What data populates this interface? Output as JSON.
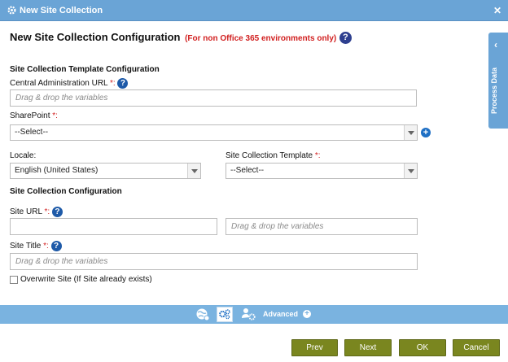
{
  "window": {
    "title": "New Site Collection",
    "icon": "gear-icon",
    "close_icon": "close-icon"
  },
  "heading": {
    "title": "New Site Collection Configuration",
    "note": "(For non Office 365 environments only)",
    "help": "?"
  },
  "template_section": {
    "title": "Site Collection Template Configuration",
    "central_admin": {
      "label": "Central Administration URL",
      "required": "*:",
      "placeholder": "Drag & drop the variables"
    },
    "sharepoint": {
      "label": "SharePoint",
      "required": "*:",
      "value": "--Select--",
      "add": "+"
    },
    "locale": {
      "label": "Locale:",
      "value": "English (United States)"
    },
    "template": {
      "label": "Site Collection Template",
      "required": "*:",
      "value": "--Select--"
    }
  },
  "config_section": {
    "title": "Site Collection Configuration",
    "site_url": {
      "label": "Site URL",
      "required": "*:",
      "value": "",
      "placeholder": "Drag & drop the variables"
    },
    "site_title": {
      "label": "Site Title",
      "required": "*:",
      "placeholder": "Drag & drop the variables"
    },
    "overwrite": {
      "label": "Overwrite Site (If Site already exists)",
      "checked": false
    }
  },
  "side_panel": {
    "label": "Process Data",
    "icon": "chevron-left-icon"
  },
  "toolbar": {
    "icons": [
      "globe-settings-icon",
      "gears-icon",
      "users-settings-icon"
    ],
    "advanced_label": "Advanced",
    "advanced_plus": "+"
  },
  "buttons": {
    "prev": "Prev",
    "next": "Next",
    "ok": "OK",
    "cancel": "Cancel"
  },
  "colors": {
    "titlebar": "#6aa4d6",
    "toolbar": "#7ab3e0",
    "button": "#7a861f",
    "required": "#d11f1f"
  }
}
